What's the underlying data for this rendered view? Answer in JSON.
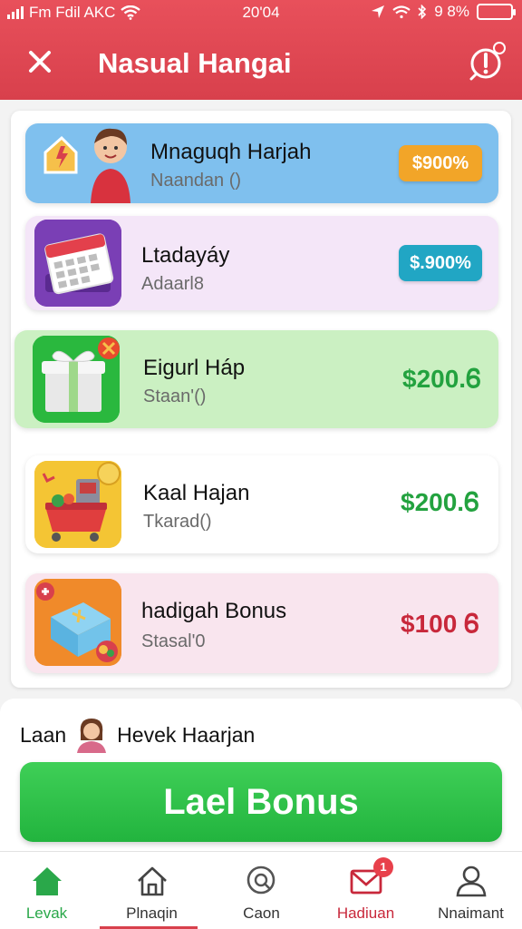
{
  "status_bar": {
    "carrier": "Fm Fdil AKC",
    "time": "20'04",
    "battery": "9 8%",
    "battery_level": 0.98
  },
  "header": {
    "title": "Nasual Hangai",
    "close_icon": "close-icon",
    "alert_icon": "alert-icon"
  },
  "cards": [
    {
      "name": "Mnaguqh Harjah",
      "sub": "Naandan ()",
      "value": "$900%",
      "value_style": "pill",
      "value_color": "#f2a528",
      "bg": "#7fc0ee",
      "icon": "star-badge-icon"
    },
    {
      "name": "Ltadayáy",
      "sub": "Adaarl8",
      "value": "$.900%",
      "value_style": "pill",
      "value_color": "#21a6c4",
      "bg": "#f4e6f8",
      "icon": "calendar-icon"
    },
    {
      "name": "Eigurl Háp",
      "sub": "Staan'()",
      "value": "$200.Ꮾ",
      "value_style": "text",
      "value_color": "#23a23f",
      "bg": "#cbf0c2",
      "icon": "gift-box-icon"
    },
    {
      "name": "Kaal Hajan",
      "sub": "Tkarad()",
      "value": "$200.Ꮾ",
      "value_style": "text",
      "value_color": "#23a23f",
      "bg": "#ffffff",
      "icon": "shopping-cart-icon"
    },
    {
      "name": "hadigah Bonus",
      "sub": "Stasal'0",
      "value": "$100 Ꮾ",
      "value_style": "text",
      "value_color": "#c8283b",
      "bg": "#f9e5ee",
      "icon": "bonus-box-icon"
    }
  ],
  "bottom": {
    "lean_label": "Laan",
    "lean_name": "Hevek Haarjan",
    "cta_label": "Lael Bonus"
  },
  "tabs": [
    {
      "label": "Levak",
      "icon": "home-filled-icon",
      "active": true
    },
    {
      "label": "Plnaqin",
      "icon": "home-outline-icon",
      "active": false
    },
    {
      "label": "Caon",
      "icon": "search-icon",
      "active": false
    },
    {
      "label": "Hadiuan",
      "icon": "mail-icon",
      "active": false,
      "badge": "1"
    },
    {
      "label": "Nnaimant",
      "icon": "user-icon",
      "active": false
    }
  ],
  "colors": {
    "header": "#d8404c",
    "cta": "#2ab846",
    "active_tab": "#2aa84a"
  }
}
